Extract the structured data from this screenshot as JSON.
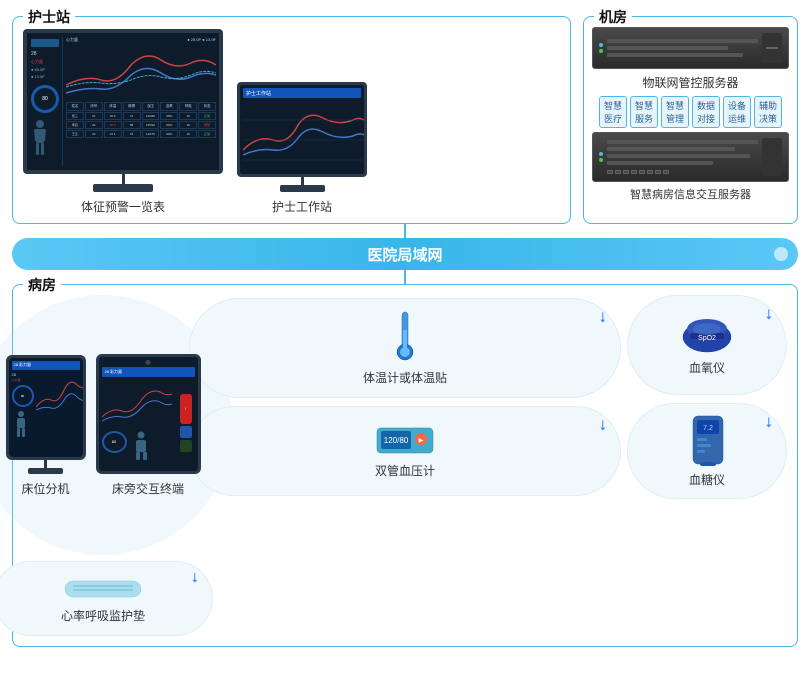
{
  "sections": {
    "nurse_station": {
      "label": "护士站",
      "device1_label": "体征预警一览表",
      "device2_label": "护士工作站"
    },
    "machine_room": {
      "label": "机房",
      "server1_name": "物联网管控服务器",
      "services": [
        "智慧医疗",
        "智慧服务",
        "智慧管理",
        "数据对接",
        "设备运维",
        "辅助决策"
      ],
      "server2_name": "智慧病房信息交互服务器"
    },
    "network": {
      "label": "医院局域网"
    },
    "ward": {
      "label": "病房",
      "device_thermometer": "体温计或体温贴",
      "device_oximeter": "血氧仪",
      "device_bp": "双管血压计",
      "device_glucose": "血糖仪",
      "device_bed_unit": "床位分机",
      "device_bedside_terminal": "床旁交互终端",
      "device_sleep_mat": "心率呼吸监护垫"
    }
  }
}
